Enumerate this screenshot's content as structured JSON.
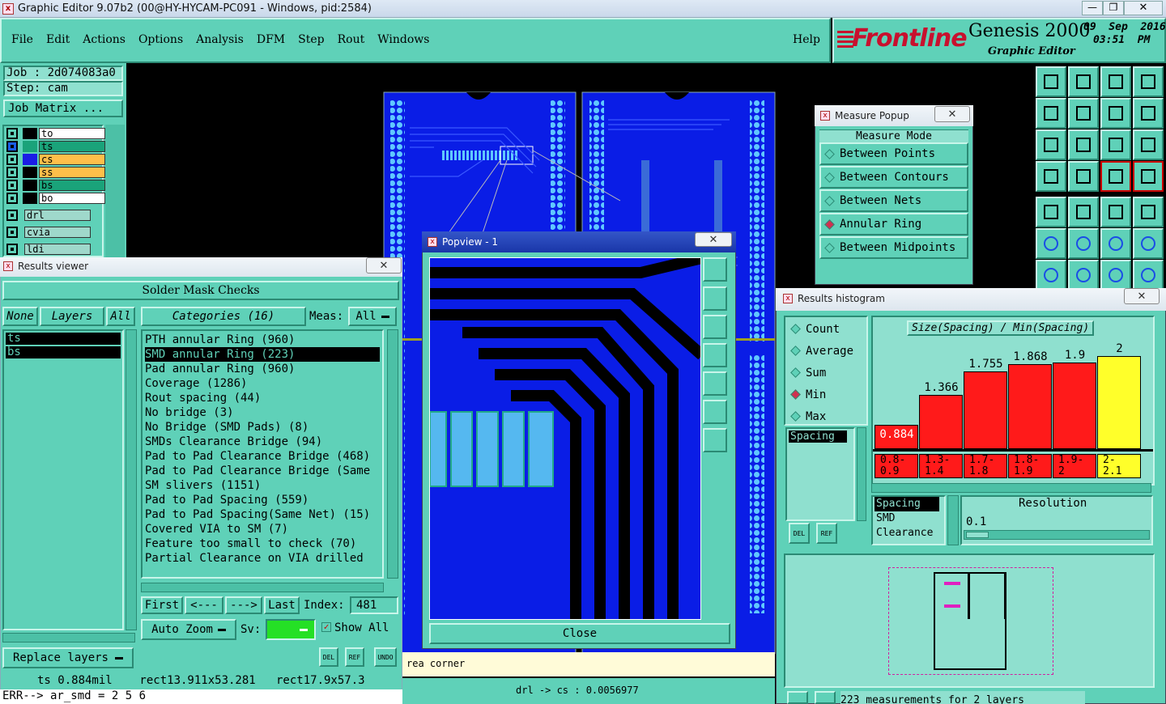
{
  "titlebar": {
    "title": "Graphic Editor 9.07b2 (00@HY-HYCAM-PC091 - Windows, pid:2584)"
  },
  "menu": {
    "items": [
      "File",
      "Edit",
      "Actions",
      "Options",
      "Analysis",
      "DFM",
      "Step",
      "Rout",
      "Windows"
    ],
    "help": "Help"
  },
  "brand": {
    "logo": "Frontline",
    "product": "Genesis 2000",
    "subtitle": "Graphic Editor",
    "date": "09  Sep  2016",
    "time": "03:51  PM"
  },
  "job": {
    "job": "Job  : 2d074083a0",
    "step": "Step: cam",
    "matrix": "Job Matrix ..."
  },
  "layers": [
    {
      "name": "to",
      "color": "#ffffff",
      "mark": "+"
    },
    {
      "name": "ts",
      "color": "#1aa37a",
      "mark": "+"
    },
    {
      "name": "cs",
      "color": "#ffbf4a",
      "mark": ""
    },
    {
      "name": "ss",
      "color": "#ffbf4a",
      "mark": ""
    },
    {
      "name": "bs",
      "color": "#1aa37a",
      "mark": ""
    },
    {
      "name": "bo",
      "color": "#ffffff",
      "mark": ""
    },
    {
      "name": "drl",
      "color": "#9fd8cb",
      "mark": ""
    },
    {
      "name": "cvia",
      "color": "#9fd8cb",
      "mark": ""
    },
    {
      "name": "ldi",
      "color": "#9fd8cb",
      "mark": ""
    }
  ],
  "results_viewer": {
    "title": "Results viewer",
    "header": "Solder Mask Checks",
    "none": "None",
    "layers": "Layers",
    "all": "All",
    "layer_list": [
      "ts",
      "bs"
    ],
    "categories_label": "Categories (16)",
    "meas_label": "Meas:",
    "meas_value": "All",
    "categories": [
      "PTH annular Ring (960)",
      "SMD annular Ring (223)",
      "Pad annular Ring (960)",
      "Coverage (1286)",
      "Rout spacing (44)",
      "No bridge (3)",
      "No Bridge (SMD Pads) (8)",
      "SMDs Clearance Bridge (94)",
      "Pad to Pad Clearance Bridge (468)",
      "Pad to Pad Clearance Bridge (Same",
      "SM slivers (1151)",
      "Pad to Pad Spacing (559)",
      "Pad to Pad Spacing(Same Net) (15)",
      "Covered VIA to SM (7)",
      "Feature too small to check (70)",
      "Partial Clearance on VIA drilled"
    ],
    "selected_index": 1,
    "first": "First",
    "prev": "<---",
    "next": "--->",
    "last": "Last",
    "index_label": "Index:",
    "index_value": "481",
    "auto_zoom": "Auto Zoom",
    "sv": "Sv:",
    "show_all": "Show All",
    "replace_layers": "Replace layers",
    "del": "DEL",
    "ref": "REF",
    "undo": "UNDO",
    "status": "ts 0.884mil    rect13.911x53.281   rect17.9x57.3",
    "err": "ERR--> ar_smd = 2 5 6"
  },
  "popview": {
    "title": "Popview - 1",
    "close": "Close"
  },
  "measure": {
    "title": "Measure Popup",
    "mode": "Measure Mode",
    "options": [
      "Between Points",
      "Between Contours",
      "Between Nets",
      "Annular Ring",
      "Between Midpoints"
    ],
    "selected": 3
  },
  "histogram": {
    "title": "Results histogram",
    "modes": [
      "Count",
      "Average",
      "Sum",
      "Min",
      "Max"
    ],
    "selected_mode": 3,
    "chart_title": "Size(Spacing) / Min(Spacing)",
    "values": [
      0.884,
      1.366,
      1.755,
      1.868,
      1.9,
      2
    ],
    "labels": [
      "0.884",
      "1.366",
      "1.755",
      "1.868",
      "1.9",
      "2"
    ],
    "bins": [
      "0.8-\n0.9",
      "1.3-\n1.4",
      "1.7-\n1.8",
      "1.8-\n1.9",
      "1.9-\n2",
      "2-\n2.1"
    ],
    "spacing_tag": "Spacing",
    "attr_list": [
      "Spacing",
      "SMD",
      "Clearance"
    ],
    "resolution_label": "Resolution",
    "resolution_value": "0.1",
    "del": "DEL",
    "ref": "REF",
    "footer": "223 measurements for 2 layers"
  },
  "canvas": {
    "area_corner": "rea corner",
    "drl_status": "drl -> cs : 0.0056977"
  }
}
